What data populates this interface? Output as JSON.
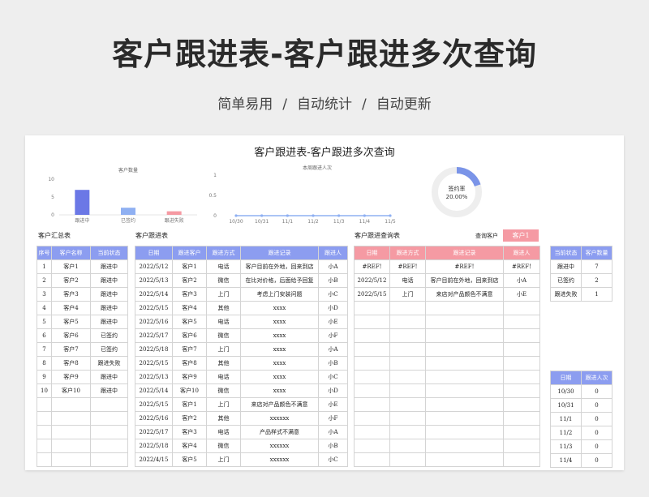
{
  "hero": {
    "title": "客户跟进表-客户跟进多次查询",
    "features": [
      "简单易用",
      "自动统计",
      "自动更新"
    ],
    "separator": "/"
  },
  "sheet": {
    "title": "客户跟进表-客户跟进多次查询"
  },
  "colors": {
    "blue_header": "#8c9df0",
    "pink_header": "#f59aa3",
    "bar_blue": "#6b78e6",
    "bar_lightblue": "#8fb0f2",
    "bar_pink": "#f59aa3",
    "line_blue": "#8fb0f2",
    "donut_fill": "#7a94e8",
    "donut_track": "#eeeeee"
  },
  "chart_data": [
    {
      "type": "bar",
      "title": "客户数量",
      "categories": [
        "跟进中",
        "已签约",
        "跟进失败"
      ],
      "values": [
        7,
        2,
        1
      ],
      "yticks": [
        0,
        5,
        10
      ],
      "ylim": [
        0,
        10
      ]
    },
    {
      "type": "line",
      "title": "本周跟进人次",
      "x": [
        "10/30",
        "10/31",
        "11/1",
        "11/2",
        "11/3",
        "11/4",
        "11/5"
      ],
      "values": [
        0,
        0,
        0,
        0,
        0,
        0,
        0
      ],
      "yticks": [
        0,
        0.5,
        1
      ],
      "ylim": [
        0,
        1
      ]
    },
    {
      "type": "pie",
      "label": "签约率",
      "value_text": "20.00%",
      "fraction": 0.2
    }
  ],
  "summary": {
    "label": "客户汇总表",
    "headers": [
      "序号",
      "客户名称",
      "当前状态"
    ],
    "rows": [
      [
        "1",
        "客户1",
        "跟进中"
      ],
      [
        "2",
        "客户2",
        "跟进中"
      ],
      [
        "3",
        "客户3",
        "跟进中"
      ],
      [
        "4",
        "客户4",
        "跟进中"
      ],
      [
        "5",
        "客户5",
        "跟进中"
      ],
      [
        "6",
        "客户6",
        "已签约"
      ],
      [
        "7",
        "客户7",
        "已签约"
      ],
      [
        "8",
        "客户8",
        "跟进失败"
      ],
      [
        "9",
        "客户9",
        "跟进中"
      ],
      [
        "10",
        "客户10",
        "跟进中"
      ],
      [
        "",
        "",
        ""
      ],
      [
        "",
        "",
        ""
      ],
      [
        "",
        "",
        ""
      ],
      [
        "",
        "",
        ""
      ],
      [
        "",
        "",
        ""
      ]
    ]
  },
  "followup": {
    "label": "客户跟进表",
    "headers": [
      "日期",
      "跟进客户",
      "跟进方式",
      "跟进记录",
      "跟进人"
    ],
    "rows": [
      [
        "2022/5/12",
        "客户1",
        "电话",
        "客户目前在外地，回来到店",
        "小A"
      ],
      [
        "2022/5/13",
        "客户2",
        "微信",
        "在比对价格，后面给予回复",
        "小B"
      ],
      [
        "2022/5/14",
        "客户3",
        "上门",
        "考虑上门安装问题",
        "小C"
      ],
      [
        "2022/5/15",
        "客户4",
        "其他",
        "xxxx",
        "小D"
      ],
      [
        "2022/5/16",
        "客户5",
        "电话",
        "xxxx",
        "小E"
      ],
      [
        "2022/5/17",
        "客户6",
        "微信",
        "xxxx",
        "小F"
      ],
      [
        "2022/5/18",
        "客户7",
        "上门",
        "xxxx",
        "小A"
      ],
      [
        "2022/5/15",
        "客户8",
        "其他",
        "xxxx",
        "小B"
      ],
      [
        "2022/5/13",
        "客户9",
        "电话",
        "xxxx",
        "小C"
      ],
      [
        "2022/5/14",
        "客户10",
        "微信",
        "xxxx",
        "小D"
      ],
      [
        "2022/5/15",
        "客户1",
        "上门",
        "来店对产品颜色不满意",
        "小E"
      ],
      [
        "2022/5/16",
        "客户2",
        "其他",
        "xxxxxx",
        "小F"
      ],
      [
        "2022/5/17",
        "客户3",
        "电话",
        "产品样式不满意",
        "小A"
      ],
      [
        "2022/5/18",
        "客户4",
        "微信",
        "xxxxxx",
        "小B"
      ],
      [
        "2022/4/15",
        "客户5",
        "上门",
        "xxxxxx",
        "小C"
      ]
    ]
  },
  "query": {
    "label": "客户跟进查询表",
    "query_label": "查询客户",
    "query_value": "客户1",
    "headers": [
      "日期",
      "跟进方式",
      "跟进记录",
      "跟进人"
    ],
    "rows": [
      [
        "#REF!",
        "#REF!",
        "#REF!",
        "#REF!"
      ],
      [
        "2022/5/12",
        "电话",
        "客户目前在外地，回来到店",
        "小A"
      ],
      [
        "2022/5/15",
        "上门",
        "来店对产品颜色不满意",
        "小E"
      ],
      [
        "",
        "",
        "",
        ""
      ],
      [
        "",
        "",
        "",
        ""
      ],
      [
        "",
        "",
        "",
        ""
      ],
      [
        "",
        "",
        "",
        ""
      ],
      [
        "",
        "",
        "",
        ""
      ],
      [
        "",
        "",
        "",
        ""
      ],
      [
        "",
        "",
        "",
        ""
      ],
      [
        "",
        "",
        "",
        ""
      ],
      [
        "",
        "",
        "",
        ""
      ],
      [
        "",
        "",
        "",
        ""
      ],
      [
        "",
        "",
        "",
        ""
      ],
      [
        "",
        "",
        "",
        ""
      ]
    ]
  },
  "status_stats": {
    "headers": [
      "当前状态",
      "客户数量"
    ],
    "rows": [
      [
        "跟进中",
        "7"
      ],
      [
        "已签约",
        "2"
      ],
      [
        "跟进失败",
        "1"
      ]
    ]
  },
  "daily_stats": {
    "headers": [
      "日期",
      "跟进人次"
    ],
    "rows": [
      [
        "10/30",
        "0"
      ],
      [
        "10/31",
        "0"
      ],
      [
        "11/1",
        "0"
      ],
      [
        "11/2",
        "0"
      ],
      [
        "11/3",
        "0"
      ],
      [
        "11/4",
        "0"
      ]
    ]
  }
}
